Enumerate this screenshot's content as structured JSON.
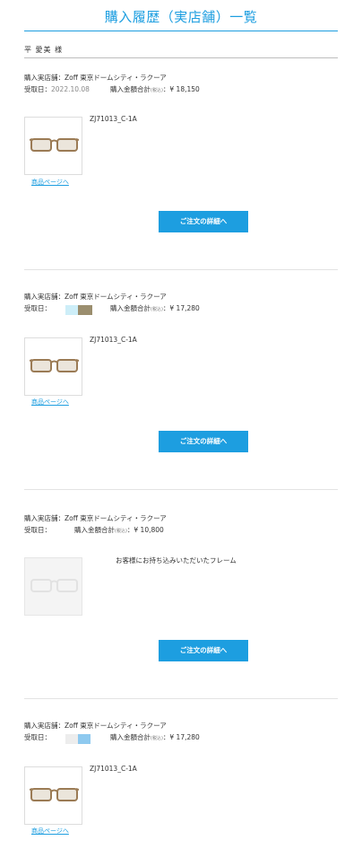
{
  "page": {
    "title": "購入履歴（実店舗）一覧"
  },
  "user": {
    "name": "平 愛美 様"
  },
  "labels": {
    "store_prefix": "購入実店舗：",
    "received_prefix": "受取日：",
    "amount_prefix": "購入金額合計",
    "tax_note": "(税込)",
    "amount_colon": "：",
    "product_link": "商品ページへ",
    "detail_button": "ご注文の詳細へ"
  },
  "orders": [
    {
      "store": "Zoff 東京ドームシティ・ラクーア",
      "received_date": "2022.10.08",
      "amount": "¥ 18,150",
      "product": "ZJ71013_C-1A",
      "has_link": true
    },
    {
      "store": "Zoff 東京ドームシティ・ラクーア",
      "received_date": "",
      "amount": "¥ 17,280",
      "product": "ZJ71013_C-1A",
      "has_link": true
    },
    {
      "store": "Zoff 東京ドームシティ・ラクーア",
      "received_date": "",
      "amount": "¥ 10,800",
      "product": "お客様にお持ち込みいただいたフレーム",
      "has_link": false
    },
    {
      "store": "Zoff 東京ドームシティ・ラクーア",
      "received_date": "",
      "amount": "¥ 17,280",
      "product": "ZJ71013_C-1A",
      "has_link": true
    }
  ],
  "colors": {
    "accent": "#1d9ee0",
    "frame": "#9b7b55",
    "lens_tint": "#c9b8a0"
  }
}
